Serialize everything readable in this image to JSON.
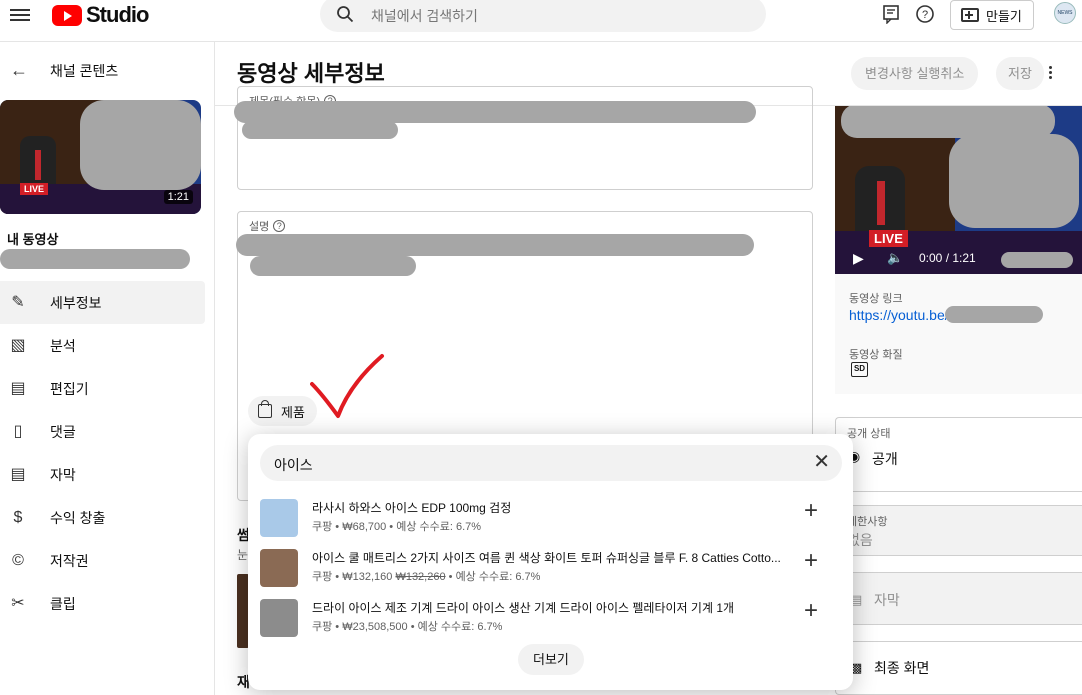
{
  "topbar": {
    "logo_text": "Studio",
    "search_placeholder": "채널에서 검색하기",
    "create_label": "만들기",
    "avatar_text": "NEWS"
  },
  "sidebar": {
    "back_label": "채널 콘텐츠",
    "thumb_live": "LIVE",
    "thumb_duration": "1:21",
    "my_video_label": "내 동영상",
    "items": [
      {
        "label": "세부정보",
        "icon": "pencil-icon",
        "active": true
      },
      {
        "label": "분석",
        "icon": "analytics-icon"
      },
      {
        "label": "편집기",
        "icon": "editor-icon"
      },
      {
        "label": "댓글",
        "icon": "comments-icon"
      },
      {
        "label": "자막",
        "icon": "subtitles-icon"
      },
      {
        "label": "수익 창출",
        "icon": "dollar-icon"
      },
      {
        "label": "저작권",
        "icon": "copyright-icon"
      },
      {
        "label": "클립",
        "icon": "scissors-icon"
      }
    ]
  },
  "main": {
    "title": "동영상 세부정보",
    "undo_label": "변경사항 실행취소",
    "save_label": "저장",
    "title_field_label": "제목(필수 항목)",
    "description_field_label": "설명",
    "products_label": "제품",
    "thumbnail_partial": "썸",
    "thumbnail_hint_partial": "눈",
    "playlist_partial": "재"
  },
  "right": {
    "video_live": "LIVE",
    "video_time": "0:00 / 1:21",
    "link_label": "동영상 링크",
    "link_value": "https://youtu.be/",
    "quality_label": "동영상 화질",
    "quality_badge": "SD",
    "visibility_label": "공개 상태",
    "visibility_value": "공개",
    "restriction_label": "제한사항",
    "restriction_value": "없음",
    "subtitles_label": "자막",
    "endscreen_label": "최종 화면"
  },
  "popup": {
    "query": "아이스",
    "more_label": "더보기",
    "products": [
      {
        "title": "라사시 하와스 아이스 EDP 100mg 검정",
        "store": "쿠팡",
        "price": "₩68,700",
        "old_price": "",
        "commission": "예상 수수료: 6.7%",
        "image_color": "#a9c9e8"
      },
      {
        "title": "아이스 쿨 매트리스 2가지 사이즈 여름 퀸 색상 화이트 토퍼 슈퍼싱글 블루 F. 8 Catties Cotto...",
        "store": "쿠팡",
        "price": "₩132,160",
        "old_price": "₩132,260",
        "commission": "예상 수수료: 6.7%",
        "image_color": "#8a6a54"
      },
      {
        "title": "드라이 아이스 제조 기계 드라이 아이스 생산 기계 드라이 아이스 펠레타이저 기계 1개",
        "store": "쿠팡",
        "price": "₩23,508,500",
        "old_price": "",
        "commission": "예상 수수료: 6.7%",
        "image_color": "#8c8c8c"
      }
    ]
  },
  "colors": {
    "brand_red": "#ff0000",
    "link_blue": "#065fd4",
    "checkmark_red": "#e01b22"
  }
}
